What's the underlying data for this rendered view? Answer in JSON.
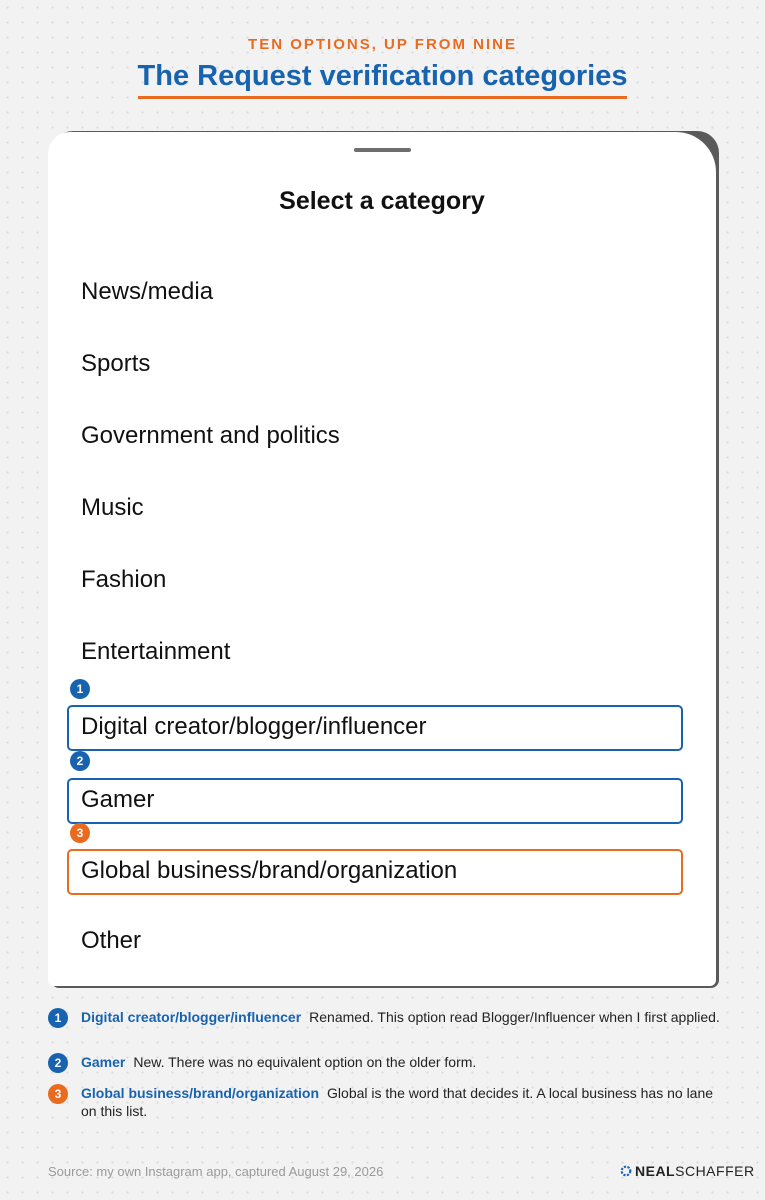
{
  "header": {
    "kicker": "TEN OPTIONS, UP FROM NINE",
    "title": "The Request verification categories"
  },
  "sheet": {
    "title": "Select a category",
    "items": [
      "News/media",
      "Sports",
      "Government and politics",
      "Music",
      "Fashion",
      "Entertainment",
      "Digital creator/blogger/influencer",
      "Gamer",
      "Global business/brand/organization",
      "Other"
    ]
  },
  "badges": [
    "1",
    "2",
    "3"
  ],
  "notes": [
    {
      "number": "1",
      "name": "Digital creator/blogger/influencer",
      "text": "Renamed. This option read Blogger/Influencer when I first applied."
    },
    {
      "number": "2",
      "name": "Gamer",
      "text": "New. There was no equivalent option on the older form."
    },
    {
      "number": "3",
      "name": "Global business/brand/organization",
      "text": "Global is the word that decides it. A local business has no lane on this list."
    }
  ],
  "footer": {
    "source": "Source: my own Instagram app, captured August 29, 2026",
    "logo_first": "NEAL",
    "logo_second": "SCHAFFER"
  },
  "colors": {
    "blue_accent": "#1763b0",
    "orange_accent": "#ea6a1f",
    "background": "#f2f2f2"
  }
}
